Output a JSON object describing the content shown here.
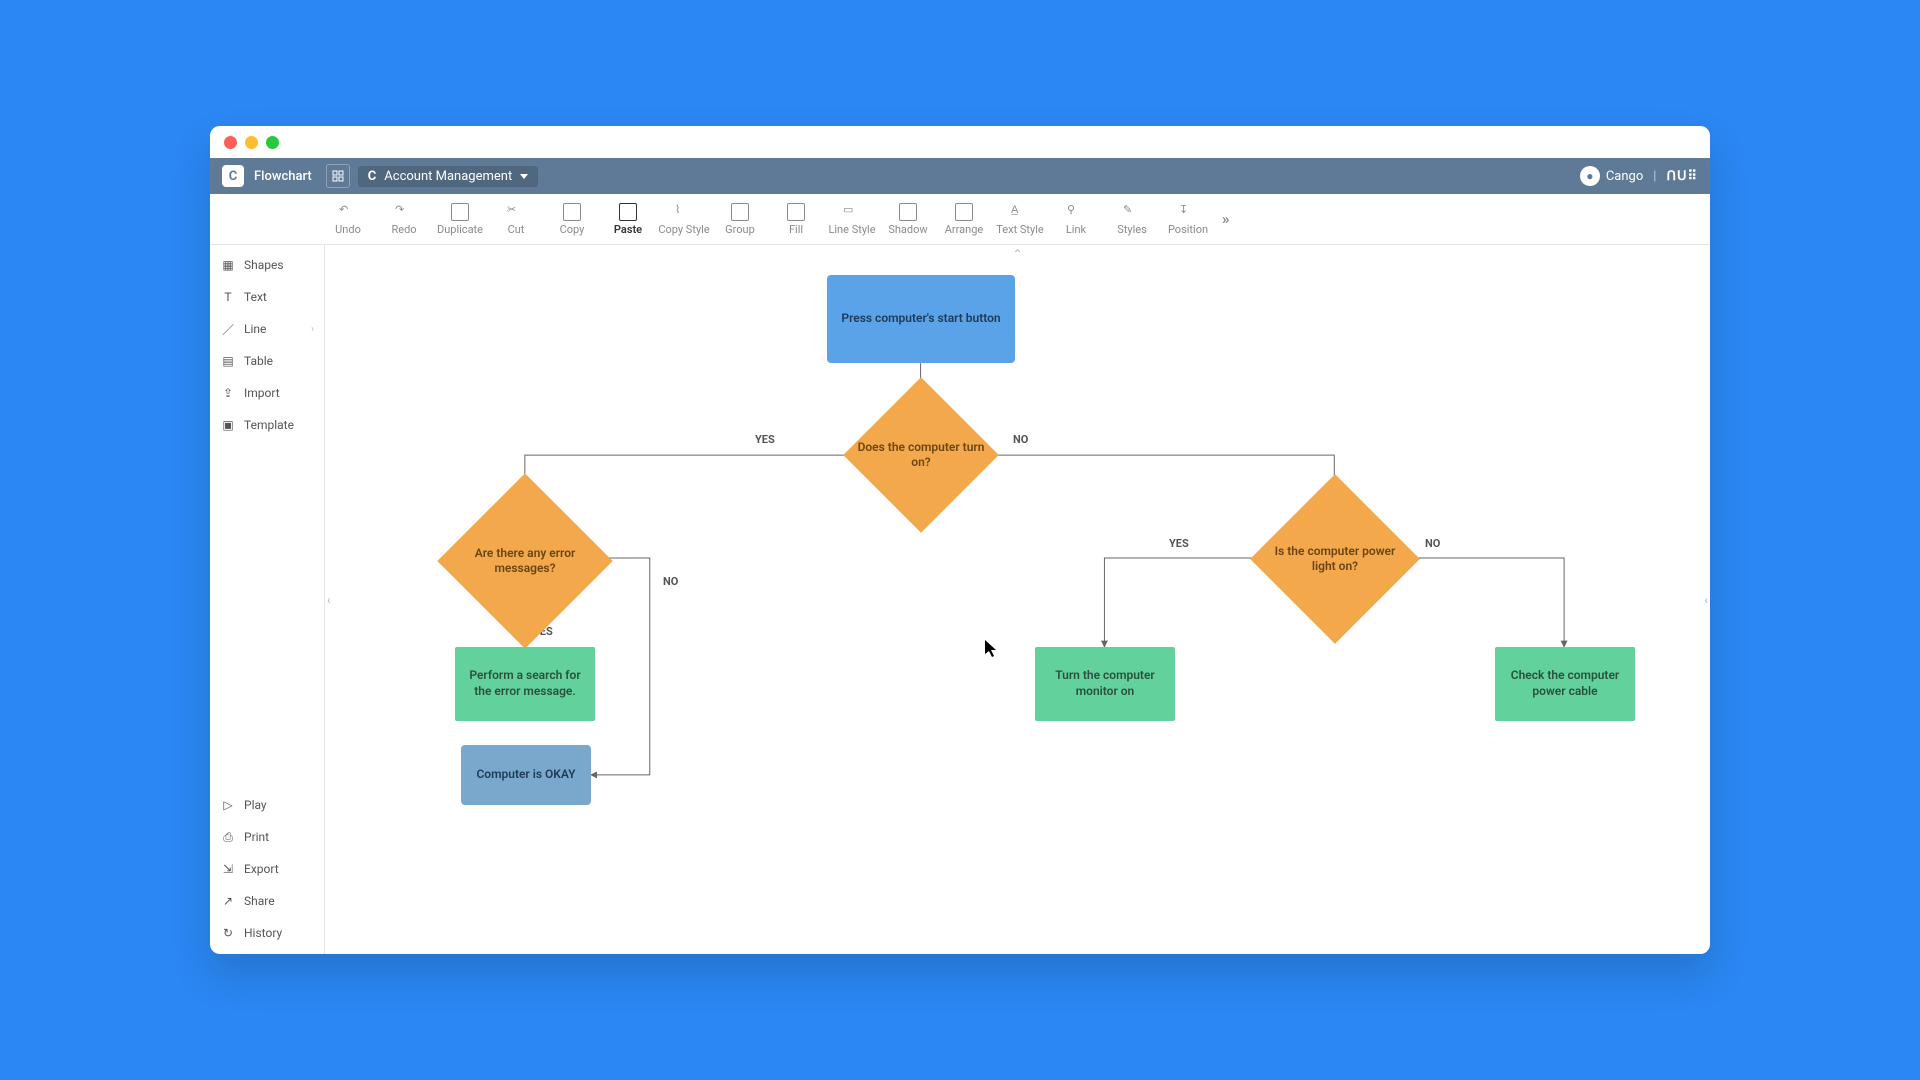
{
  "app": {
    "title": "Flowchart",
    "project": "Account Management",
    "user": "Cango",
    "brand": "ᑎᑌ⠿"
  },
  "toolbar": {
    "items": [
      "Undo",
      "Redo",
      "Duplicate",
      "Cut",
      "Copy",
      "Paste",
      "Copy Style",
      "Group",
      "Fill",
      "Line Style",
      "Shadow",
      "Arrange",
      "Text Style",
      "Link",
      "Styles",
      "Position"
    ],
    "active_index": 5
  },
  "sidebar": {
    "top": [
      {
        "label": "Shapes",
        "icon": "shapes"
      },
      {
        "label": "Text",
        "icon": "text"
      },
      {
        "label": "Line",
        "icon": "line",
        "expandable": true
      },
      {
        "label": "Table",
        "icon": "table"
      },
      {
        "label": "Import",
        "icon": "import"
      },
      {
        "label": "Template",
        "icon": "template"
      }
    ],
    "bottom": [
      {
        "label": "Play",
        "icon": "play"
      },
      {
        "label": "Print",
        "icon": "print"
      },
      {
        "label": "Export",
        "icon": "export"
      },
      {
        "label": "Share",
        "icon": "share"
      },
      {
        "label": "History",
        "icon": "history"
      }
    ]
  },
  "flow": {
    "nodes": {
      "start": "Press computer's start button",
      "d1": "Does the computer turn on?",
      "d2": "Are there any error messages?",
      "d3": "Is the computer power light on?",
      "g1": "Perform a search for the error message.",
      "g2": "Turn the computer monitor on",
      "g3": "Check the computer power cable",
      "ok": "Computer is OKAY"
    },
    "labels": {
      "yes": "YES",
      "no": "NO"
    }
  }
}
